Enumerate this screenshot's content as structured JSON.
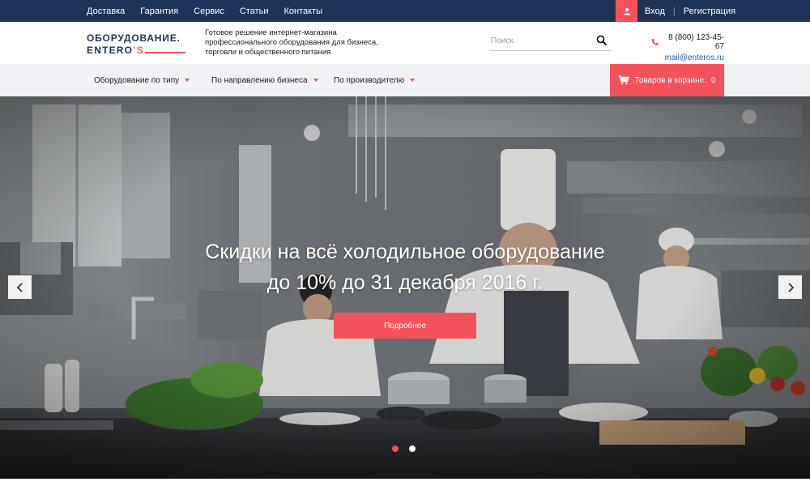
{
  "topbar": {
    "nav": [
      "Доставка",
      "Гарантия",
      "Сервис",
      "Статьи",
      "Контакты"
    ],
    "user_icon": "user-icon",
    "login": "Вход",
    "separator": "|",
    "register": "Регистрация",
    "bg_color": "#1f3359",
    "accent_color": "#f4525a"
  },
  "header": {
    "logo_line1": "ОБОРУДОВАНИЕ.",
    "logo_line2_prefix": "ENTERO",
    "logo_line2_suffix": "’S",
    "tagline": "Готовое решение интернет-магазина профессионального оборудования для бизнеса, торговли и общественного питания",
    "search_placeholder": "Поиск",
    "search_value": "",
    "phone": "8 (800) 123-45-67",
    "email": "mail@enteros.ru"
  },
  "nav": {
    "items": [
      "Оборудование по типу",
      "По направлению бизнеса",
      "По производителю"
    ],
    "cart_label": "Товаров в корзине:",
    "cart_count": "0"
  },
  "hero": {
    "headline_line1": "Скидки на всё холодильное оборудование",
    "headline_line2": "до 10% до 31 декабря 2016 г.",
    "button": "Подробнее",
    "prev_icon": "chevron-left-icon",
    "next_icon": "chevron-right-icon",
    "slides_total": 2,
    "slide_active": 1
  }
}
